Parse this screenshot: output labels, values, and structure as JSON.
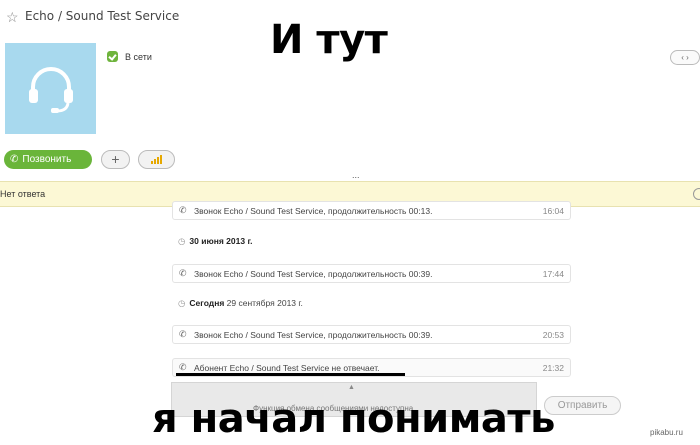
{
  "header": {
    "title": "Echo / Sound Test Service",
    "star_icon": "star-icon"
  },
  "contact": {
    "status": "В сети",
    "avatar_icon": "headset-icon",
    "avatar_color": "#a8d9ee"
  },
  "meme": {
    "top": "И тут",
    "bottom": "я начал понимать"
  },
  "actions": {
    "call_label": "Позвонить",
    "add_icon": "+",
    "call_color": "#6ab53a"
  },
  "banner": {
    "text": "Нет ответа",
    "color": "#fcf8d5"
  },
  "conversation": {
    "msg1": {
      "text": "Звонок Echo / Sound Test Service, продолжительность 00:13.",
      "time": "16:04"
    },
    "date2": {
      "bold": "30 июня 2013 г.",
      "rest": ""
    },
    "msg3": {
      "text": "Звонок Echo / Sound Test Service, продолжительность 00:39.",
      "time": "17:44"
    },
    "date4": {
      "bold": "Сегодня",
      "rest": "29 сентября 2013 г."
    },
    "msg5": {
      "text": "Звонок Echo / Sound Test Service, продолжительность 00:39.",
      "time": "20:53"
    },
    "msg6": {
      "text": "Абонент Echo / Sound Test Service не отвечает.",
      "time": "21:32"
    }
  },
  "input": {
    "note": "Функция обмена сообщениями недоступна.",
    "send_label": "Отправить"
  },
  "nav": {
    "more": "...",
    "arrows": "‹ ›"
  },
  "watermark": "pikabu.ru"
}
